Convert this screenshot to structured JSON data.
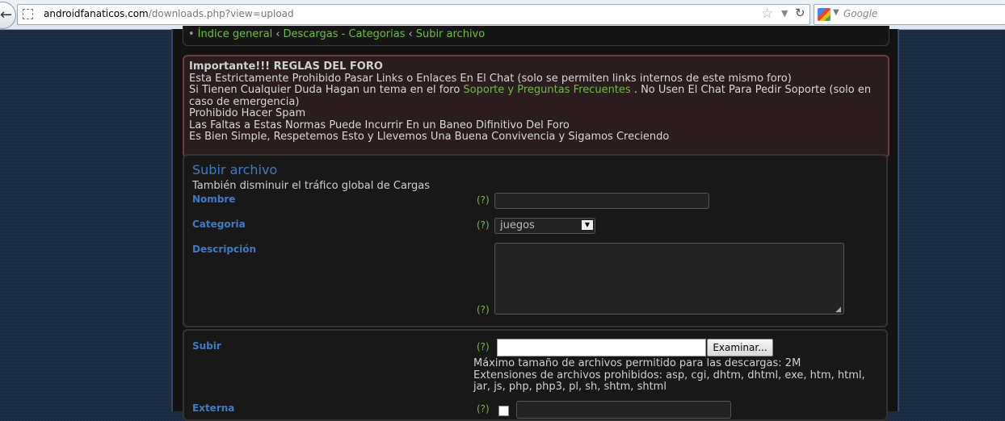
{
  "browser": {
    "url_host": "androidfanaticos.com",
    "url_path": "/downloads.php?view=upload",
    "search_placeholder": "Google"
  },
  "breadcrumbs": [
    "Índice general",
    "Descargas - Categorias",
    "Subir archivo"
  ],
  "rules": {
    "title": "Importante!!! REGLAS DEL FORO",
    "line1": "Esta Estrictamente Prohibido Pasar Links o Enlaces En El Chat (solo se permiten links internos de este mismo foro)",
    "line2_before": "Si Tienen Cualquier Duda Hagan un tema en el foro ",
    "line2_link": "Soporte y Preguntas Frecuentes",
    "line2_after": " . No Usen El Chat Para Pedir Soporte (solo en caso de emergencia)",
    "line3": "Prohibido Hacer Spam",
    "line4": "Las Faltas a Estas Normas Puede Incurrir En un Baneo Difinitivo Del Foro",
    "line5": "Es Bien Simple, Respetemos Esto y Llevemos Una Buena Convivencia y Sigamos Creciendo"
  },
  "upload_form": {
    "title": "Subir archivo",
    "subtitle": "También disminuir el tráfico global de Cargas",
    "help_marker": "(?)",
    "name_label": "Nombre",
    "name_value": "",
    "category_label": "Categoria",
    "category_value": "juegos",
    "description_label": "Descripción",
    "description_value": ""
  },
  "file_section": {
    "upload_label": "Subir",
    "browse_button": "Examinar...",
    "max_size": "Máximo tamaño de archivos permitido para las descargas: 2M",
    "forbidden_ext": "Extensiones de archivos prohibidos: asp, cgi, dhtm, dhtml, exe, htm, html, jar, js, php, php3, pl, sh, shtm, shtml",
    "external_label": "Externa"
  }
}
